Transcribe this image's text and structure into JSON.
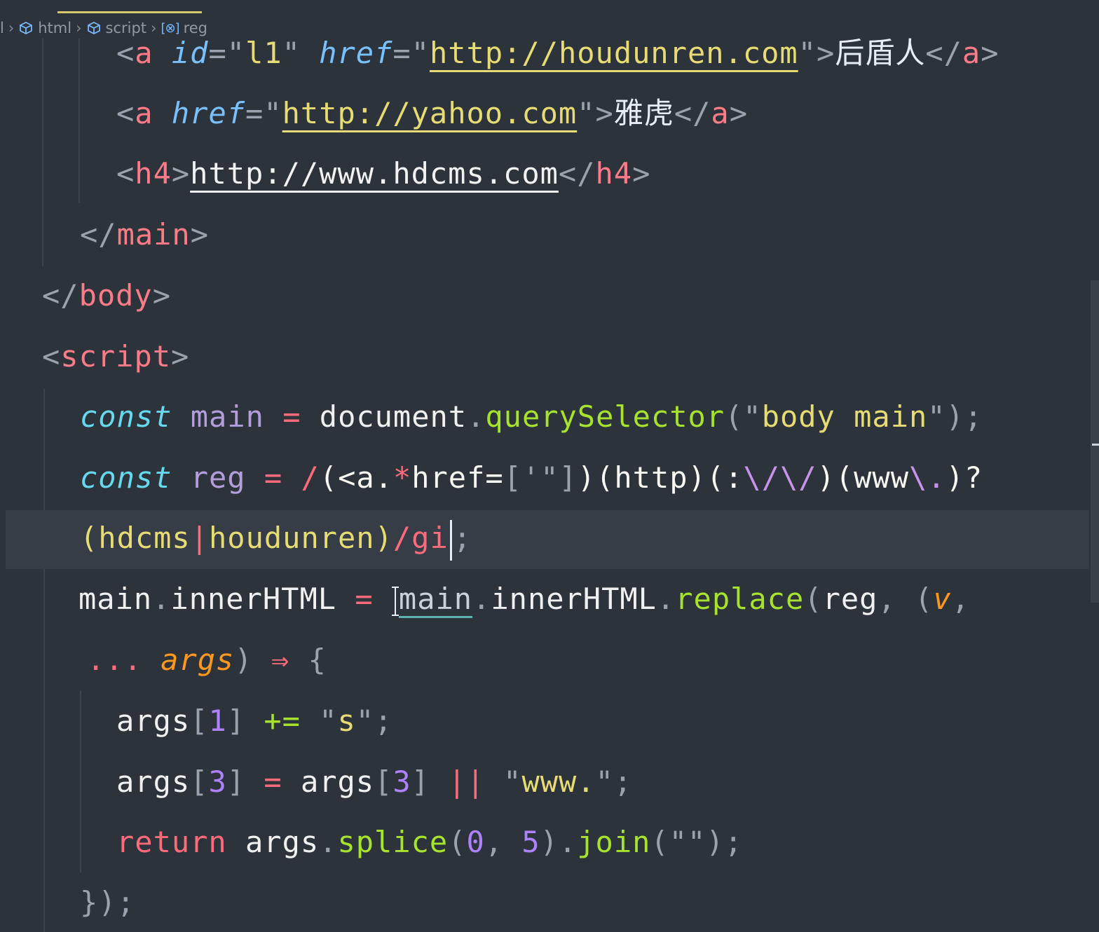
{
  "breadcrumb": {
    "root": "l",
    "items": [
      "html",
      "script",
      "reg"
    ]
  },
  "code": {
    "line1": {
      "open": "<",
      "tag": "a",
      "attr1": "id",
      "eq": "=",
      "q": "\"",
      "id_val": "l1",
      "attr2": "href",
      "url": "http://houdunren.com",
      "close": ">",
      "text": "后盾人",
      "end_open": "</",
      "end_tag": "a",
      "end_close": ">"
    },
    "line2": {
      "open": "<",
      "tag": "a",
      "attr": "href",
      "eq": "=",
      "q": "\"",
      "url": "http://yahoo.com",
      "close": ">",
      "text": "雅虎",
      "end_open": "</",
      "end_tag": "a",
      "end_close": ">"
    },
    "line3": {
      "open": "<",
      "tag": "h4",
      "close": ">",
      "url": "http://www.hdcms.com",
      "end_open": "</",
      "end_tag": "h4",
      "end_close": ">"
    },
    "line4": {
      "open": "</",
      "tag": "main",
      "close": ">"
    },
    "line5": {
      "open": "</",
      "tag": "body",
      "close": ">"
    },
    "line6": {
      "open": "<",
      "tag": "script",
      "close": ">"
    },
    "line7": {
      "kw": "const",
      "name": "main",
      "op": "=",
      "obj": "document",
      "dot": ".",
      "fn": "querySelector",
      "p1": "(",
      "q": "\"",
      "arg": "body main",
      "p2": ")",
      "semi": ";"
    },
    "line8": {
      "kw": "const",
      "name": "reg",
      "op": "=",
      "slash": "/",
      "g1": "(<a.",
      "star": "*",
      "g1b": "href=",
      "cls": "['\"]",
      "g1c": ")(http)(:",
      "esc": "\\/\\/",
      "g1d": ")(www",
      "esc2": "\\.",
      "g1e": ")?"
    },
    "line9": {
      "g2a": "(hdcms",
      "pipe": "|",
      "g2b": "houdunren)",
      "flags": "/gi",
      "semi": ";"
    },
    "line10": {
      "lhs": "main",
      "dot": ".",
      "prop": "innerHTML",
      "op": "=",
      "ref": "main",
      "prop2": "innerHTML",
      "fn": "replace",
      "p": "(",
      "arg1": "reg",
      "comma": ",",
      "p2": "(",
      "param": "v",
      "comma2": ","
    },
    "line11": {
      "spread": "...",
      "param": "args",
      "p": ")",
      "arrow": "⇒",
      "brace": "{"
    },
    "line12": {
      "obj": "args",
      "b1": "[",
      "idx": "1",
      "b2": "]",
      "op": "+=",
      "q": "\"",
      "val": "s",
      "semi": ";"
    },
    "line13": {
      "obj": "args",
      "b1": "[",
      "idx": "3",
      "b2": "]",
      "op": "=",
      "obj2": "args",
      "idx2": "3",
      "or": "||",
      "q": "\"",
      "val": "www.",
      "semi": ";"
    },
    "line14": {
      "kw": "return",
      "obj": "args",
      "dot": ".",
      "fn": "splice",
      "p": "(",
      "n1": "0",
      "comma": ",",
      "n2": "5",
      "p2": ")",
      "fn2": "join",
      "q": "\"\"",
      "semi": ";"
    },
    "line15": {
      "text": "});"
    }
  },
  "colors": {
    "background": "#2d333b",
    "highlight_line": "#363d46",
    "tab_accent": "#d8c86a"
  }
}
